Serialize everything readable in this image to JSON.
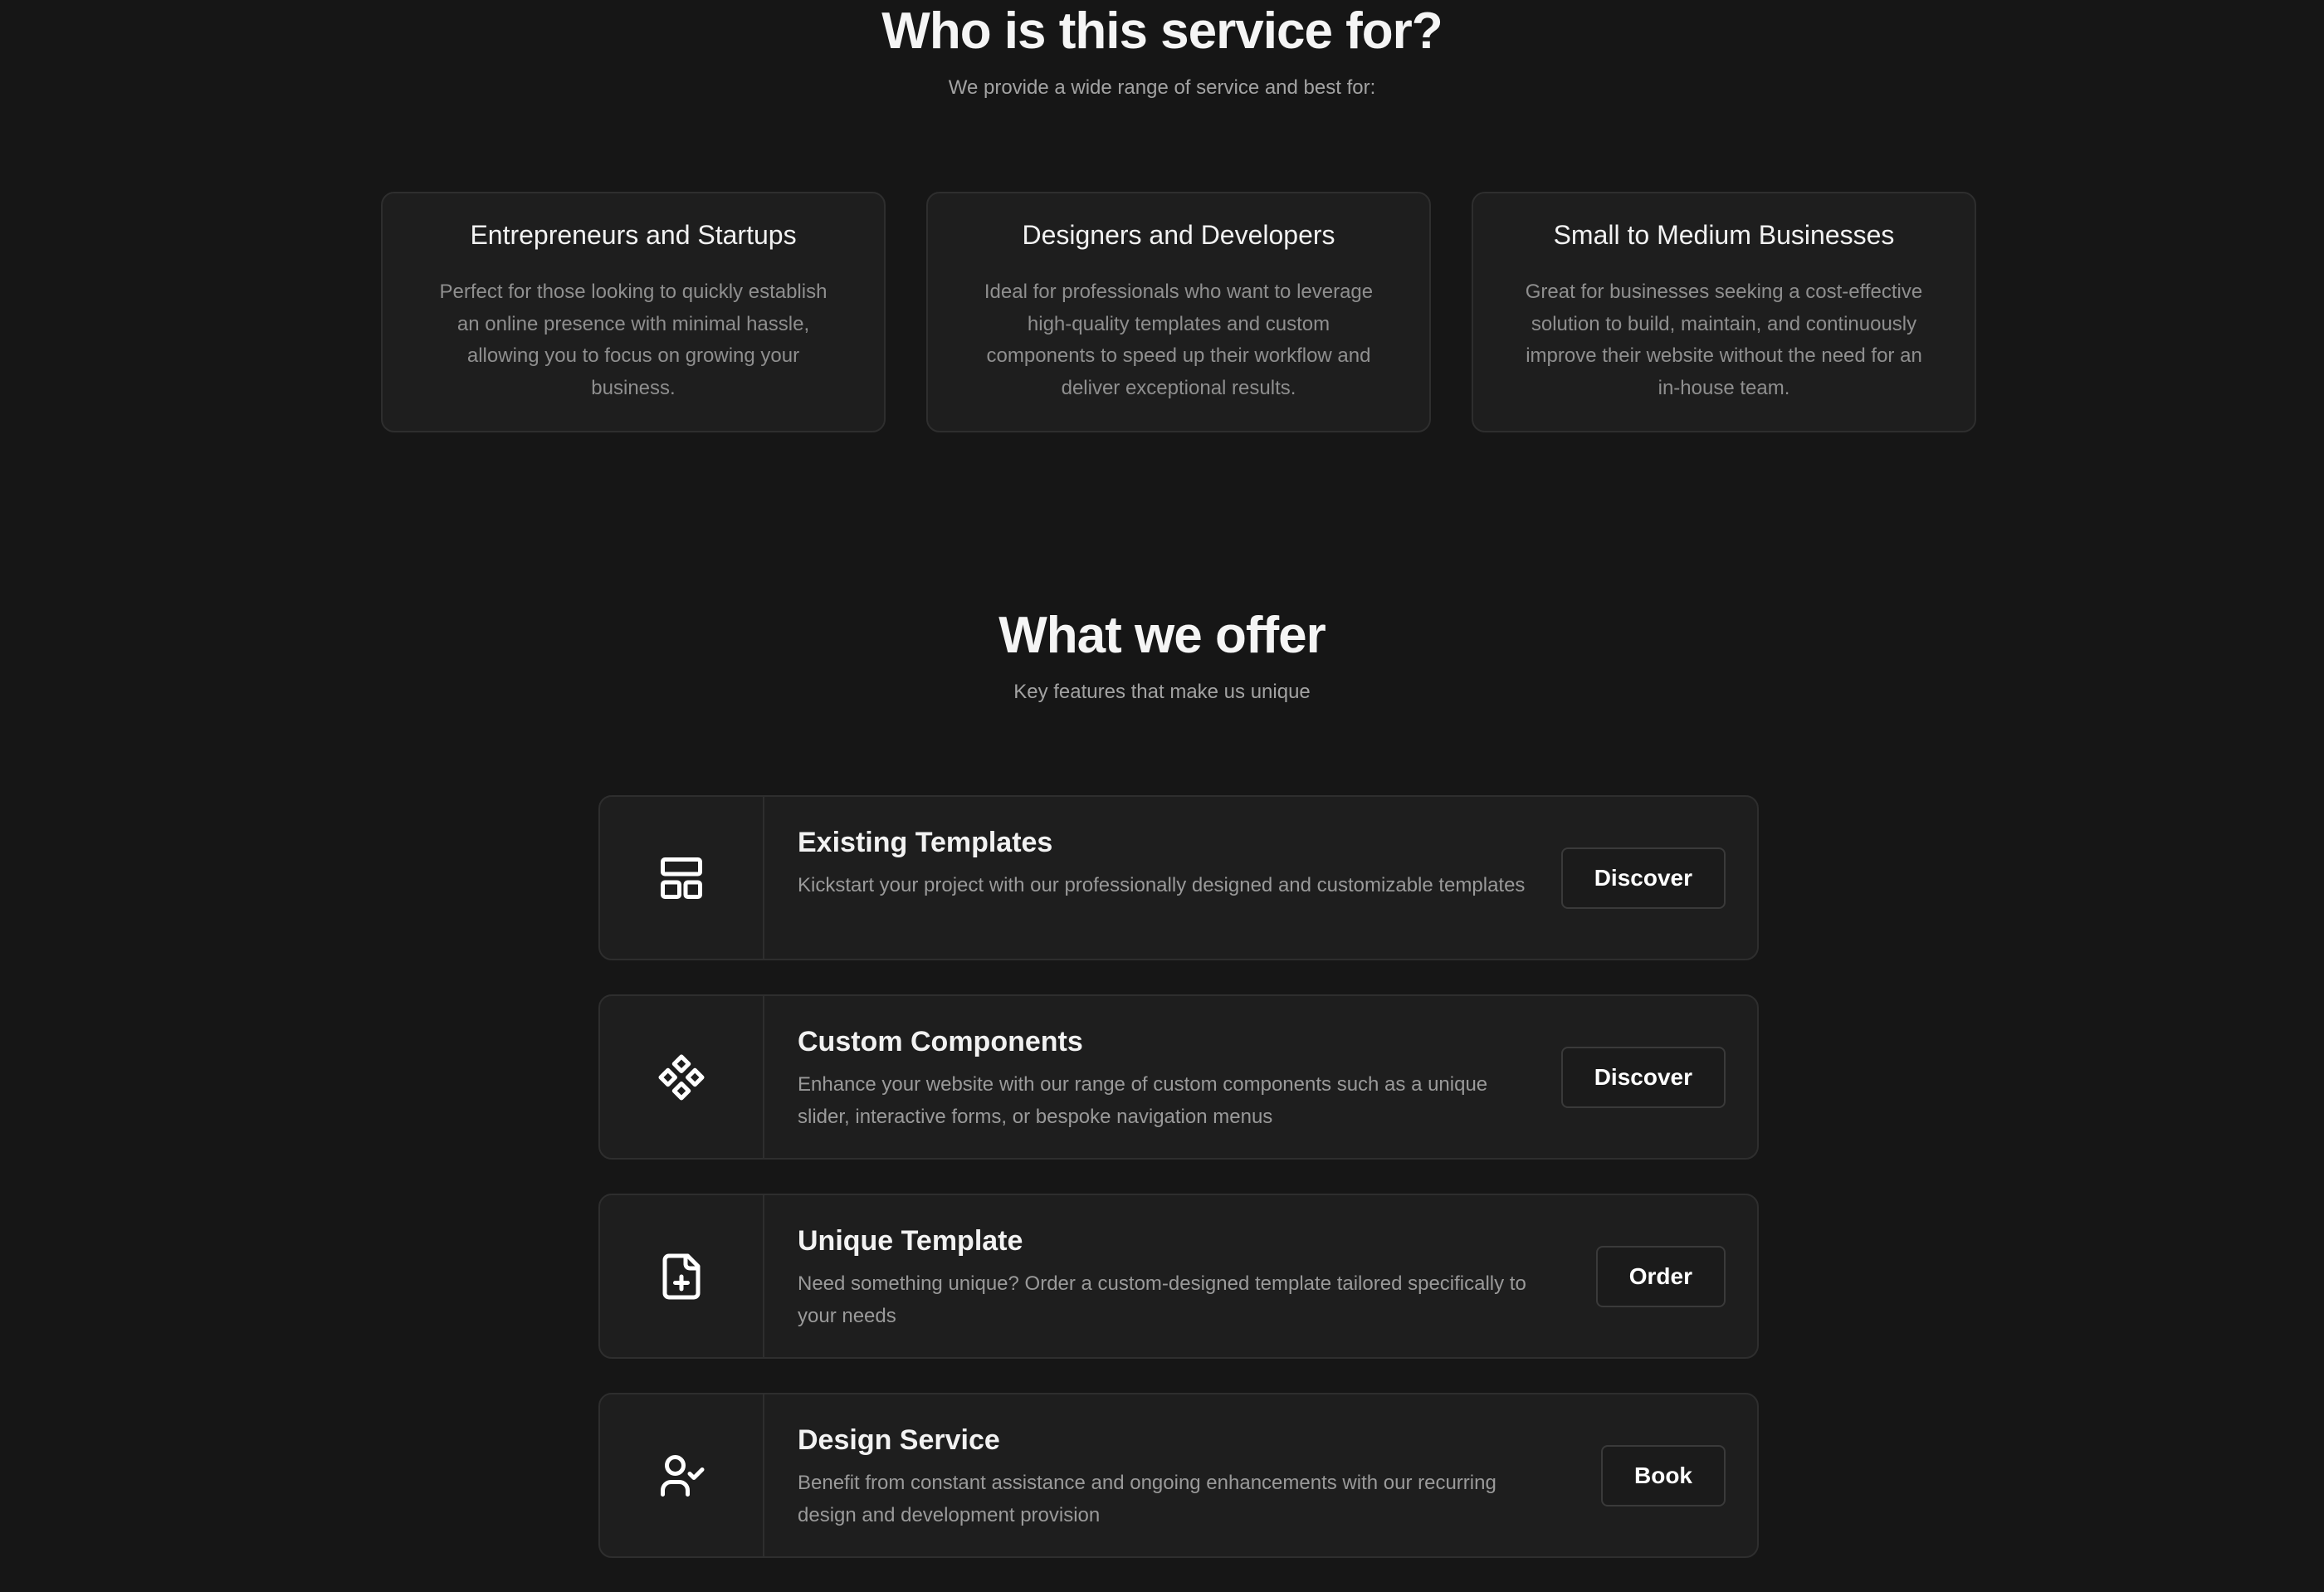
{
  "audience": {
    "title": "Who is this service for?",
    "subtitle": "We provide a wide range of service and best for:",
    "cards": [
      {
        "title": "Entrepreneurs and Startups",
        "description": "Perfect for those looking to quickly establish an online presence with minimal hassle, allowing you to focus on growing your business."
      },
      {
        "title": "Designers and Developers",
        "description": "Ideal for professionals who want to leverage high-quality templates and custom components to speed up their workflow and deliver exceptional results."
      },
      {
        "title": "Small to Medium Businesses",
        "description": "Great for businesses seeking a cost-effective solution to build, maintain, and continuously improve their website without the need for an in-house team."
      }
    ]
  },
  "offer": {
    "title": "What we offer",
    "subtitle": "Key features that make us unique",
    "items": [
      {
        "icon": "layout-template-icon",
        "title": "Existing Templates",
        "description": "Kickstart your project with our professionally designed and customizable templates",
        "button": "Discover"
      },
      {
        "icon": "components-icon",
        "title": "Custom Components",
        "description": "Enhance your website with our range of custom components such as a unique slider, interactive forms, or bespoke navigation menus",
        "button": "Discover"
      },
      {
        "icon": "file-plus-icon",
        "title": "Unique Template",
        "description": "Need something unique? Order a custom-designed template tailored specifically to your needs",
        "button": "Order"
      },
      {
        "icon": "user-check-icon",
        "title": "Design Service",
        "description": "Benefit from constant assistance and ongoing enhancements with our recurring design and development provision",
        "button": "Book"
      }
    ]
  },
  "colors": {
    "background": "#161616",
    "card_background": "#1e1e1e",
    "card_border": "#2e2e2e",
    "text_primary": "#f2f2f2",
    "text_muted": "#9a9a9a"
  }
}
